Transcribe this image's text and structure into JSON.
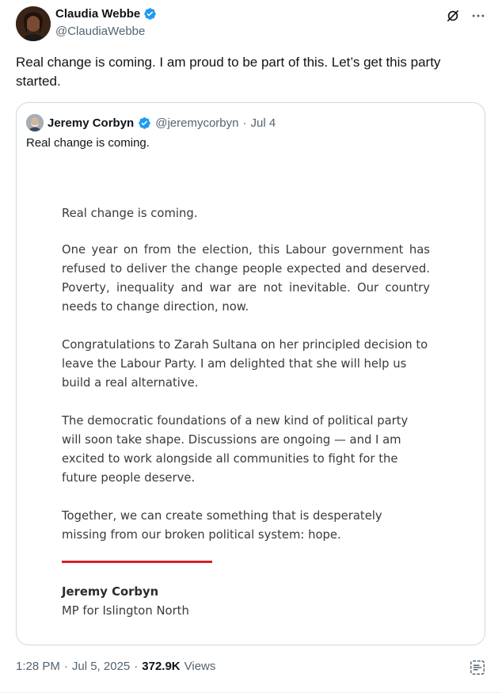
{
  "author": {
    "name": "Claudia Webbe",
    "handle": "@ClaudiaWebbe"
  },
  "post_text": "Real change is coming. I am proud to be part of this. Let’s get this party started.",
  "quote": {
    "name": "Jeremy Corbyn",
    "handle": "@jeremycorbyn",
    "separator": "·",
    "date": "Jul 4",
    "text": "Real change is coming.",
    "statement": {
      "p1": "Real change is coming.",
      "p2": "One year on from the election, this Labour government has refused to deliver the change people expected and deserved. Poverty, inequality and war are not inevitable. Our country needs to change direction, now.",
      "p3": "Congratulations to Zarah Sultana on her principled decision to leave the Labour Party. I am delighted that she will help us build a real alternative.",
      "p4": "The democratic foundations of a new kind of political party will soon take shape. Discussions are ongoing — and I am excited to work alongside all communities to fight for the future people deserve.",
      "p5": "Together, we can create something that is desperately missing from our broken political system: hope.",
      "signature_name": "Jeremy Corbyn",
      "signature_role": "MP for Islington North"
    }
  },
  "meta": {
    "time": "1:28 PM",
    "dot1": "·",
    "date": "Jul 5, 2025",
    "dot2": "·",
    "views_count": "372.9K",
    "views_label": "Views"
  },
  "icons": {
    "verified": "verified-badge-icon",
    "grok": "grok-icon",
    "more": "more-icon",
    "analytics": "analytics-icon"
  },
  "colors": {
    "verified_blue": "#1d9bf0",
    "accent_red": "#d4202a",
    "secondary_text": "#536471"
  }
}
